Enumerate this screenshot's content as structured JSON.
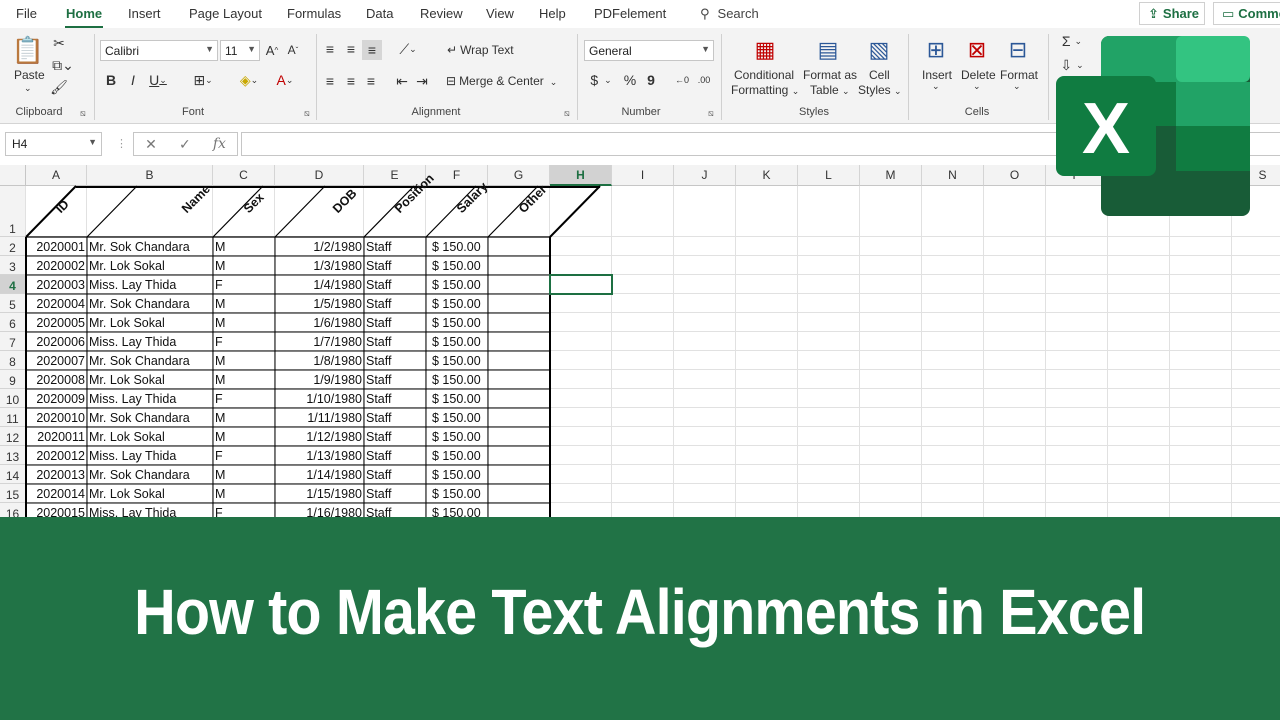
{
  "menu": {
    "tabs": [
      "File",
      "Home",
      "Insert",
      "Page Layout",
      "Formulas",
      "Data",
      "Review",
      "View",
      "Help",
      "PDFelement"
    ],
    "search": "Search",
    "share": "Share",
    "comments": "Comme"
  },
  "ribbon": {
    "clipboard": {
      "label": "Clipboard",
      "paste": "Paste"
    },
    "font": {
      "label": "Font",
      "name": "Calibri",
      "size": "11"
    },
    "alignment": {
      "label": "Alignment",
      "wrap_text": "Wrap Text",
      "merge_center": "Merge & Center"
    },
    "number": {
      "label": "Number",
      "format": "General"
    },
    "styles": {
      "label": "Styles",
      "conditional_1": "Conditional",
      "conditional_2": "Formatting",
      "format_as_1": "Format as",
      "format_as_2": "Table",
      "cell_styles_1": "Cell",
      "cell_styles_2": "Styles"
    },
    "cells": {
      "label": "Cells",
      "insert": "Insert",
      "delete": "Delete",
      "format": "Format"
    }
  },
  "formula_bar": {
    "name_box": "H4",
    "fx": "fx",
    "formula": ""
  },
  "sheet": {
    "columns": [
      "A",
      "B",
      "C",
      "D",
      "E",
      "F",
      "G",
      "H",
      "I",
      "J",
      "K",
      "L",
      "M",
      "N",
      "O",
      "P",
      "Q",
      "R",
      "S"
    ],
    "rows": [
      "1",
      "2",
      "3",
      "4",
      "5",
      "6",
      "7",
      "8",
      "9",
      "10",
      "11",
      "12",
      "13",
      "14",
      "15",
      "16"
    ],
    "headers": [
      "ID",
      "Name",
      "Sex",
      "DOB",
      "Position",
      "Salary",
      "Other"
    ],
    "data": [
      [
        "2020001",
        "Mr. Sok Chandara",
        "M",
        "1/2/1980",
        "Staff",
        "$ 150.00"
      ],
      [
        "2020002",
        "Mr. Lok Sokal",
        "M",
        "1/3/1980",
        "Staff",
        "$ 150.00"
      ],
      [
        "2020003",
        "Miss. Lay Thida",
        "F",
        "1/4/1980",
        "Staff",
        "$ 150.00"
      ],
      [
        "2020004",
        "Mr. Sok Chandara",
        "M",
        "1/5/1980",
        "Staff",
        "$ 150.00"
      ],
      [
        "2020005",
        "Mr. Lok Sokal",
        "M",
        "1/6/1980",
        "Staff",
        "$ 150.00"
      ],
      [
        "2020006",
        "Miss. Lay Thida",
        "F",
        "1/7/1980",
        "Staff",
        "$ 150.00"
      ],
      [
        "2020007",
        "Mr. Sok Chandara",
        "M",
        "1/8/1980",
        "Staff",
        "$ 150.00"
      ],
      [
        "2020008",
        "Mr. Lok Sokal",
        "M",
        "1/9/1980",
        "Staff",
        "$ 150.00"
      ],
      [
        "2020009",
        "Miss. Lay Thida",
        "F",
        "1/10/1980",
        "Staff",
        "$ 150.00"
      ],
      [
        "2020010",
        "Mr. Sok Chandara",
        "M",
        "1/11/1980",
        "Staff",
        "$ 150.00"
      ],
      [
        "2020011",
        "Mr. Lok Sokal",
        "M",
        "1/12/1980",
        "Staff",
        "$ 150.00"
      ],
      [
        "2020012",
        "Miss. Lay Thida",
        "F",
        "1/13/1980",
        "Staff",
        "$ 150.00"
      ],
      [
        "2020013",
        "Mr. Sok Chandara",
        "M",
        "1/14/1980",
        "Staff",
        "$ 150.00"
      ],
      [
        "2020014",
        "Mr. Lok Sokal",
        "M",
        "1/15/1980",
        "Staff",
        "$ 150.00"
      ],
      [
        "2020015",
        "Miss. Lay Thida",
        "F",
        "1/16/1980",
        "Staff",
        "$ 150.00"
      ]
    ]
  },
  "banner": {
    "title": "How to Make Text Alignments in Excel"
  },
  "logo": {
    "letter": "X"
  },
  "colors": {
    "accent": "#1d6f42",
    "banner": "#217346"
  }
}
